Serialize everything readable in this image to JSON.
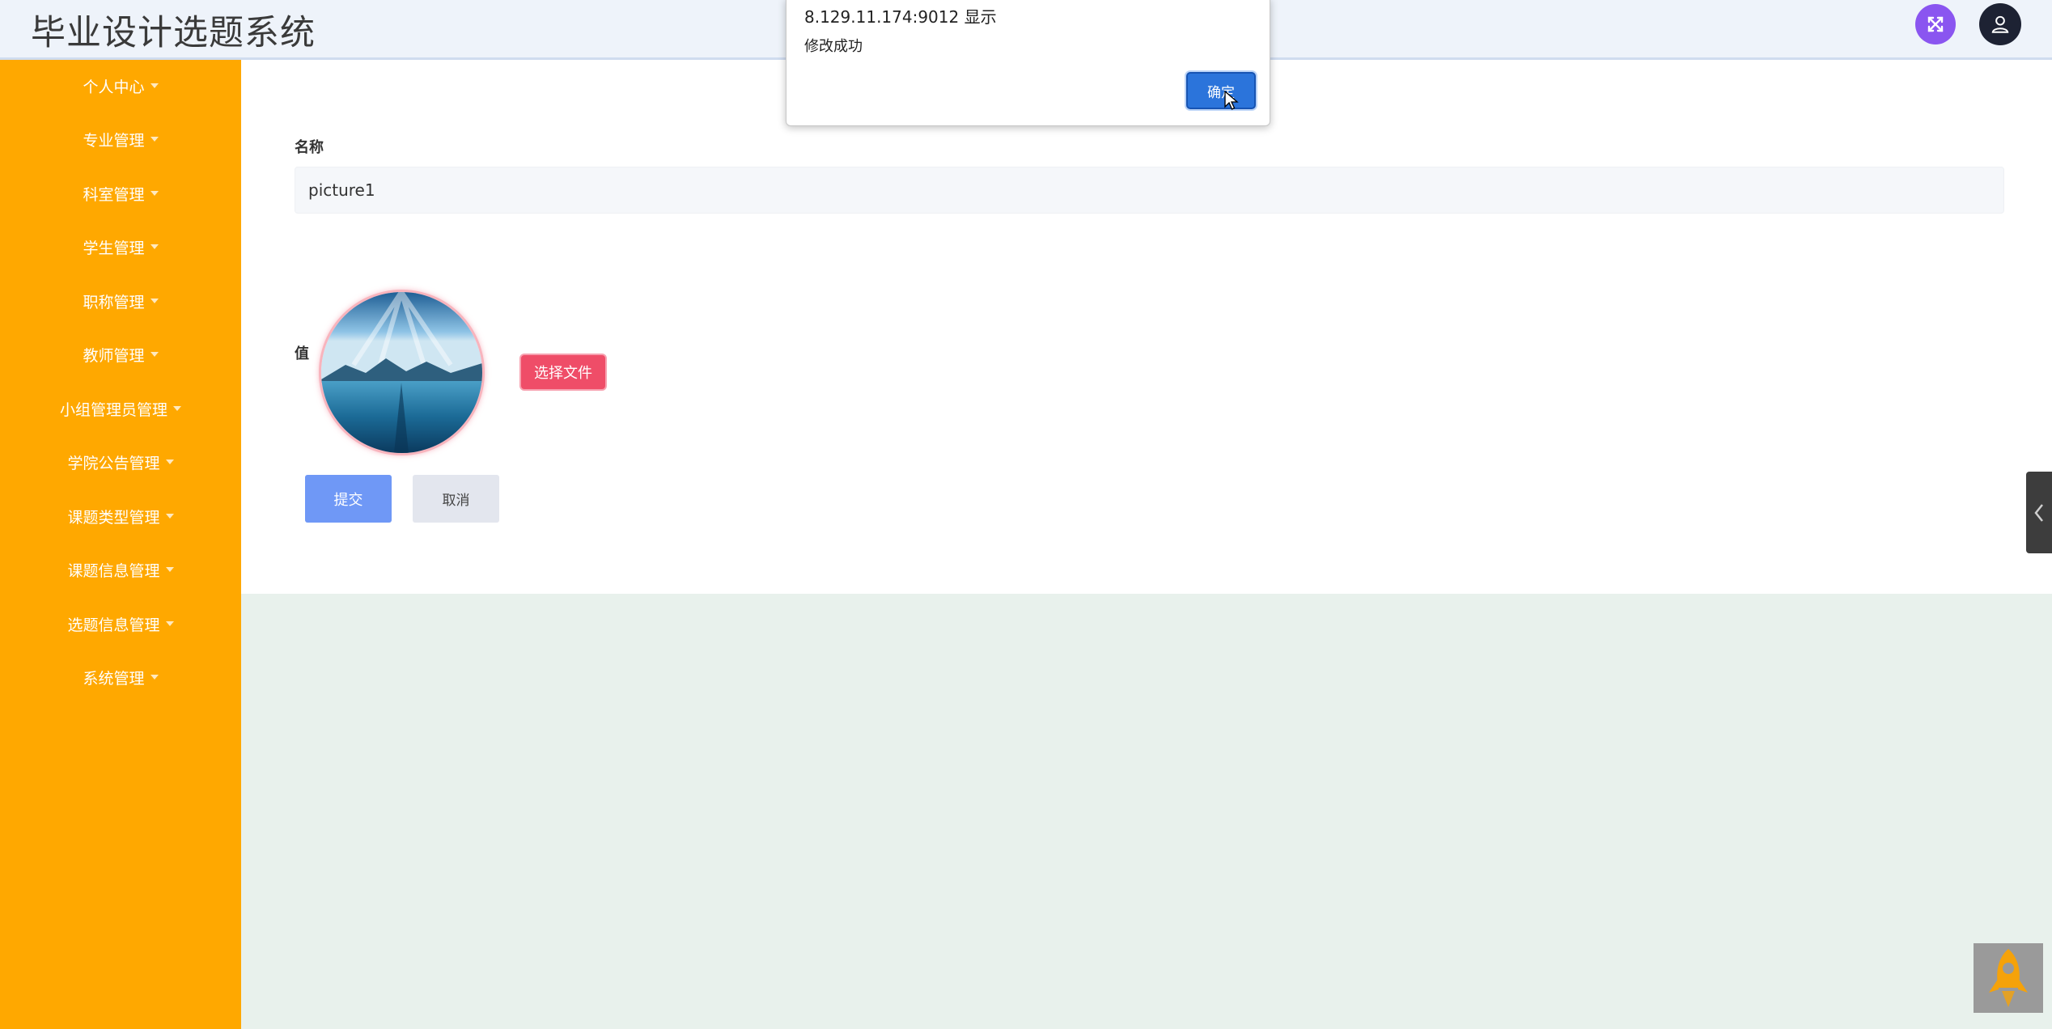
{
  "header": {
    "app_title": "毕业设计选题系统"
  },
  "sidebar": {
    "items": [
      {
        "label": "个人中心"
      },
      {
        "label": "专业管理"
      },
      {
        "label": "科室管理"
      },
      {
        "label": "学生管理"
      },
      {
        "label": "职称管理"
      },
      {
        "label": "教师管理"
      },
      {
        "label": "小组管理员管理"
      },
      {
        "label": "学院公告管理"
      },
      {
        "label": "课题类型管理"
      },
      {
        "label": "课题信息管理"
      },
      {
        "label": "选题信息管理"
      },
      {
        "label": "系统管理"
      }
    ]
  },
  "form": {
    "name_label": "名称",
    "name_value": "picture1",
    "value_label": "值",
    "choose_file_label": "选择文件",
    "submit_label": "提交",
    "cancel_label": "取消"
  },
  "dialog": {
    "host": "8.129.11.174:9012 显示",
    "message": "修改成功",
    "ok_label": "确定"
  },
  "colors": {
    "sidebar": "#ffa800",
    "primary": "#6f98f6",
    "danger": "#ef4d68",
    "dialog_button": "#2b74db"
  },
  "icons": {
    "fullscreen": "fullscreen-icon",
    "user": "user-icon",
    "collapse": "chevron-left-icon",
    "back_to_top": "rocket-icon"
  }
}
